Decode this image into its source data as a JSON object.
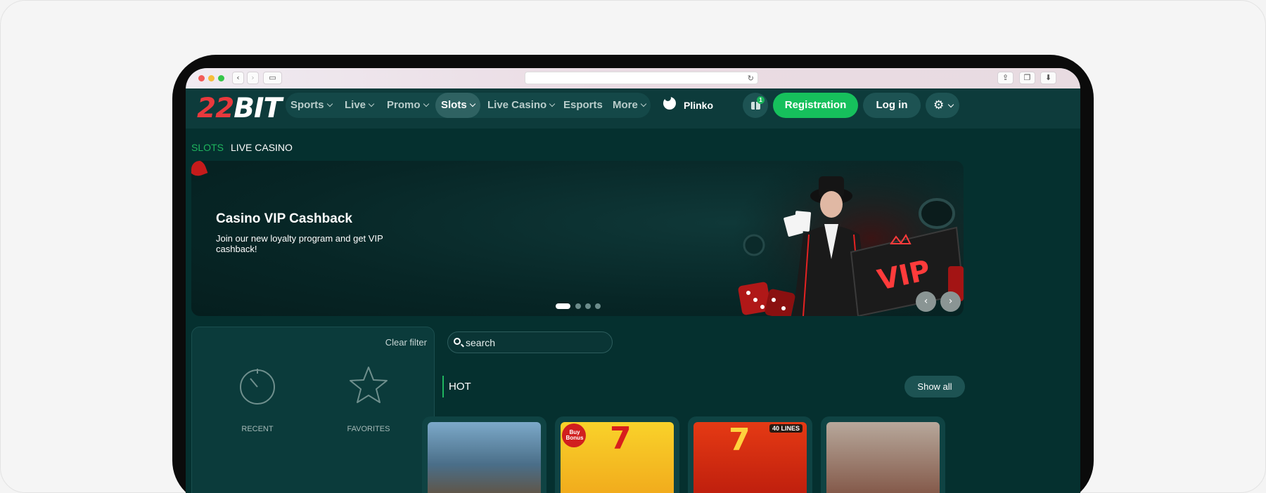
{
  "browser": {
    "back_icon": "chevron-left-icon",
    "forward_icon": "chevron-right-icon",
    "reload_icon": "reload-icon"
  },
  "header": {
    "logo_part1": "22",
    "logo_part2": "BIT",
    "nav": [
      {
        "label": "Sports",
        "active": false
      },
      {
        "label": "Live",
        "active": false
      },
      {
        "label": "Promo",
        "active": false
      },
      {
        "label": "Slots",
        "active": true
      },
      {
        "label": "Live Casino",
        "active": false
      },
      {
        "label": "Esports",
        "active": false
      },
      {
        "label": "More",
        "active": false
      }
    ],
    "plinko_label": "Plinko",
    "gift_count": "1",
    "registration_label": "Registration",
    "login_label": "Log in"
  },
  "subtabs": [
    {
      "label": "SLOTS",
      "active": true
    },
    {
      "label": "LIVE CASINO",
      "active": false
    }
  ],
  "banner": {
    "title": "Casino VIP Cashback",
    "text": "Join our new loyalty program and get VIP cashback!",
    "art_text": "VIP",
    "slide_count": 4,
    "active_slide": 1
  },
  "filter": {
    "clear_label": "Clear filter",
    "recent_label": "RECENT",
    "favorites_label": "FAVORITES"
  },
  "search": {
    "placeholder": "search"
  },
  "section": {
    "title": "HOT",
    "show_all_label": "Show all"
  },
  "games": [
    {
      "badge": ""
    },
    {
      "badge": "Buy Bonus"
    },
    {
      "badge": "40 LINES"
    },
    {
      "badge": ""
    }
  ],
  "colors": {
    "accent_green": "#16c05c",
    "logo_red": "#e8393d",
    "background": "#05302f"
  }
}
